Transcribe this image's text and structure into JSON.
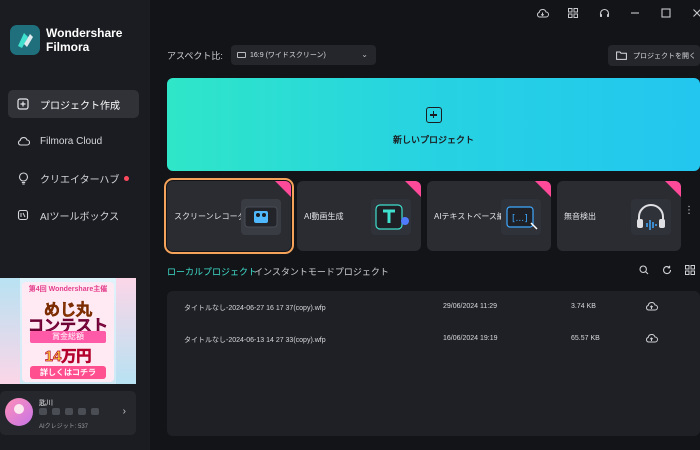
{
  "app": {
    "logo_line1": "Wondershare",
    "logo_line2": "Filmora"
  },
  "sidebar": {
    "items": [
      {
        "label": "プロジェクト作成",
        "icon": "plus-square-icon",
        "active": true
      },
      {
        "label": "Filmora Cloud",
        "icon": "cloud-icon",
        "active": false
      },
      {
        "label": "クリエイターハブ",
        "icon": "lightbulb-icon",
        "active": false,
        "dot": true
      },
      {
        "label": "AIツールボックス",
        "icon": "ai-toolbox-icon",
        "active": false
      }
    ],
    "banner": {
      "line1": "第4回 Wondershare主催",
      "line2": "めじ丸",
      "line3": "コンテスト",
      "line4": "賞金総額",
      "line5": "14万円",
      "line6": "詳しくはコチラ"
    },
    "user": {
      "name": "匙川",
      "credit": "AIクレジット: 537"
    }
  },
  "topbar": {
    "icons": [
      "cloud-download-icon",
      "grid-icon",
      "headset-icon",
      "minimize-icon",
      "maximize-icon",
      "close-icon"
    ]
  },
  "aspect": {
    "label": "アスペクト比:",
    "value": "16:9 (ワイドスクリーン)"
  },
  "open_project": {
    "label": "プロジェクトを開く"
  },
  "new_project": {
    "label": "新しいプロジェクト"
  },
  "tools": [
    {
      "label": "スクリーンレコーダー",
      "highlight": true
    },
    {
      "label": "AI動画生成",
      "highlight": false
    },
    {
      "label": "AIテキストベース編集",
      "highlight": false
    },
    {
      "label": "無音検出",
      "highlight": false
    }
  ],
  "tabs": {
    "active": "ローカルプロジェクト",
    "inactive": "インスタントモードプロジェクト"
  },
  "projects": [
    {
      "name": "タイトルなし-2024-06-27 16 17 37(copy).wfp",
      "date": "29/06/2024 11:29",
      "size": "3.74 KB"
    },
    {
      "name": "タイトルなし-2024-06-13 14 27 33(copy).wfp",
      "date": "16/06/2024 19:19",
      "size": "65.57 KB"
    }
  ],
  "colors": {
    "accent": "#3fe0cd",
    "highlight_ring": "#f5a25a",
    "badge": "#ff4a9a"
  }
}
